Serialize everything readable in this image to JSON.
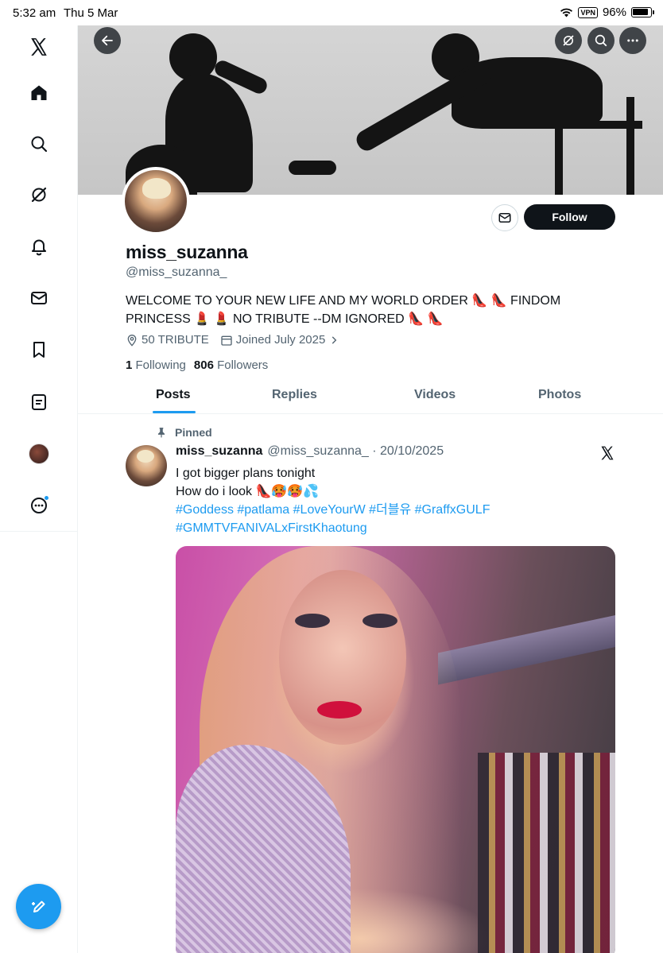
{
  "status_bar": {
    "time": "5:32 am",
    "date": "Thu 5 Mar",
    "vpn": "VPN",
    "battery": "96%"
  },
  "sidebar": {
    "items": [
      {
        "icon": "x-logo-icon"
      },
      {
        "icon": "home-icon"
      },
      {
        "icon": "search-icon"
      },
      {
        "icon": "grok-icon"
      },
      {
        "icon": "bell-icon"
      },
      {
        "icon": "mail-icon"
      },
      {
        "icon": "bookmark-icon"
      },
      {
        "icon": "lists-icon"
      },
      {
        "icon": "profile-avatar"
      },
      {
        "icon": "more-icon"
      }
    ],
    "compose_icon": "compose-icon",
    "accent": "#1d9bf0"
  },
  "profile": {
    "display_name": "miss_suzanna",
    "handle": "@miss_suzanna_",
    "bio_line1": "WELCOME TO YOUR NEW LIFE AND MY WORLD ORDER 👠 👠 FINDOM",
    "bio_line2": "PRINCESS 💄 💄 NO TRIBUTE --DM IGNORED 👠 👠",
    "location": "50 TRIBUTE",
    "joined": "Joined July 2025",
    "following_count": "1",
    "following_label": "Following",
    "followers_count": "806",
    "followers_label": "Followers",
    "follow_button": "Follow"
  },
  "tabs": [
    {
      "label": "Posts",
      "active": true
    },
    {
      "label": "Replies",
      "active": false
    },
    {
      "label": "Videos",
      "active": false
    },
    {
      "label": "Photos",
      "active": false
    }
  ],
  "tweet": {
    "pinned_label": "Pinned",
    "name": "miss_suzanna",
    "handle_date": "@miss_suzanna_ · 20/10/2025",
    "line1": "I got bigger plans tonight",
    "line2": "How do i look 👠🥵🥵💦",
    "hashtags_line1": "#Goddess #patlama #LoveYourW #더블유 #GraffxGULF",
    "hashtags_line2": "#GMMTVFANIVALxFirstKhaotung"
  },
  "colors": {
    "text": "#0f1419",
    "secondary": "#536471",
    "link": "#1d9bf0",
    "follow_bg": "#0f1419"
  }
}
